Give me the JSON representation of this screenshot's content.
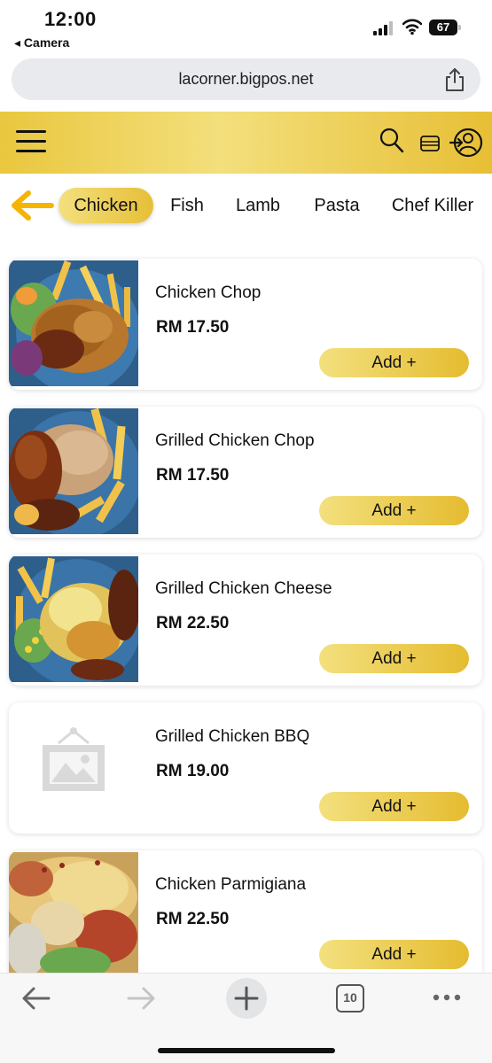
{
  "status_bar": {
    "time": "12:00",
    "back_app": "◂ Camera",
    "battery": "67"
  },
  "browser": {
    "url": "lacorner.bigpos.net",
    "tabs_count": "10"
  },
  "categories": [
    {
      "label": "Chicken",
      "active": true
    },
    {
      "label": "Fish",
      "active": false
    },
    {
      "label": "Lamb",
      "active": false
    },
    {
      "label": "Pasta",
      "active": false
    },
    {
      "label": "Chef Killer",
      "active": false
    }
  ],
  "products": [
    {
      "name": "Chicken Chop",
      "price": "RM 17.50",
      "add_label": "Add +",
      "image": "fried-chicken-photo"
    },
    {
      "name": "Grilled Chicken Chop",
      "price": "RM 17.50",
      "add_label": "Add +",
      "image": "grilled-chicken-photo"
    },
    {
      "name": "Grilled Chicken Cheese",
      "price": "RM 22.50",
      "add_label": "Add +",
      "image": "cheese-chicken-photo"
    },
    {
      "name": "Grilled Chicken BBQ",
      "price": "RM 19.00",
      "add_label": "Add +",
      "image": "placeholder-image-icon"
    },
    {
      "name": "Chicken Parmigiana",
      "price": "RM 22.50",
      "add_label": "Add +",
      "image": "parmigiana-photo"
    }
  ],
  "colors": {
    "accent_gold": "#e6bf37",
    "accent_light": "#f3e07e",
    "arrow_orange": "#f5b400"
  }
}
